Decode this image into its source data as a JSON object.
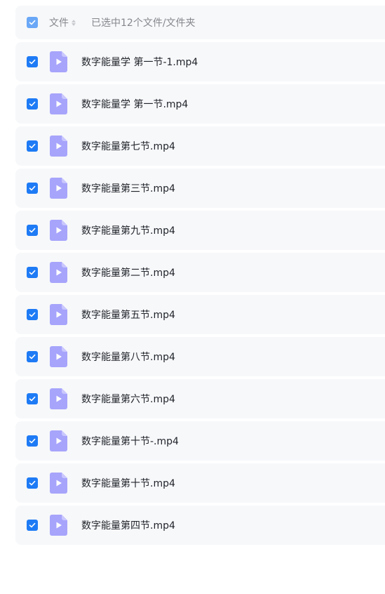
{
  "header": {
    "column_label": "文件",
    "selected_info": "已选中12个文件/文件夹"
  },
  "files": [
    {
      "name": "数字能量学 第一节-1.mp4"
    },
    {
      "name": "数字能量学 第一节.mp4"
    },
    {
      "name": "数字能量第七节.mp4"
    },
    {
      "name": "数字能量第三节.mp4"
    },
    {
      "name": "数字能量第九节.mp4"
    },
    {
      "name": "数字能量第二节.mp4"
    },
    {
      "name": "数字能量第五节.mp4"
    },
    {
      "name": "数字能量第八节.mp4"
    },
    {
      "name": "数字能量第六节.mp4"
    },
    {
      "name": "数字能量第十节-.mp4"
    },
    {
      "name": "数字能量第十节.mp4"
    },
    {
      "name": "数字能量第四节.mp4"
    }
  ],
  "icons": {
    "checkbox": "checkbox-checked-icon",
    "file": "video-file-icon",
    "sort": "sort-icon"
  },
  "colors": {
    "checkbox": "#1e7bf5",
    "file_icon": "#a6a4fb",
    "row_bg": "#f7f8fa"
  }
}
